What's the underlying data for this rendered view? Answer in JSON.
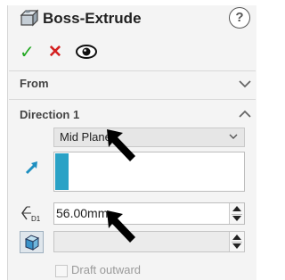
{
  "feature": {
    "title": "Boss-Extrude",
    "icon": "boss-extrude-icon",
    "help_symbol": "?"
  },
  "actions": {
    "ok": "✓",
    "cancel": "✕",
    "preview": "eye-icon"
  },
  "sections": {
    "from": {
      "label": "From",
      "state": "collapsed"
    },
    "direction1": {
      "label": "Direction 1",
      "state": "expanded"
    }
  },
  "direction1": {
    "end_condition": "Mid Plane",
    "depth_value": "56.00mm",
    "depth_icon_label": "D1",
    "draft_outward_label": "Draft outward",
    "draft_outward_checked": false
  },
  "colors": {
    "ok": "#22a822",
    "cancel": "#d42020",
    "selection_bar": "#2aa2c6",
    "direction_arrow": "#1e8fc0"
  }
}
